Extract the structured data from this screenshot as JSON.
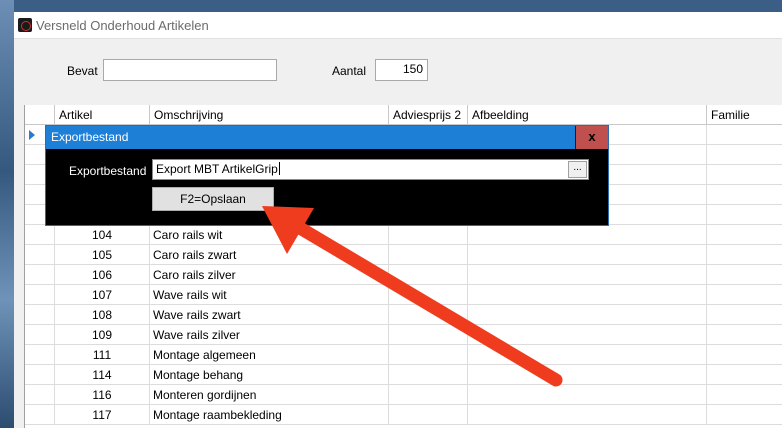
{
  "window": {
    "title": "Versneld Onderhoud Artikelen"
  },
  "filters": {
    "bevat_label": "Bevat",
    "bevat_value": "",
    "aantal_label": "Aantal",
    "aantal_value": "150"
  },
  "grid": {
    "columns": [
      "Artikel",
      "Omschrijving",
      "Adviesprijs 2",
      "Afbeelding",
      "Familie"
    ],
    "rows": [
      {
        "artikel": "104",
        "omschrijving": "Caro rails wit"
      },
      {
        "artikel": "105",
        "omschrijving": "Caro rails zwart"
      },
      {
        "artikel": "106",
        "omschrijving": "Caro rails zilver"
      },
      {
        "artikel": "107",
        "omschrijving": "Wave rails wit"
      },
      {
        "artikel": "108",
        "omschrijving": "Wave rails zwart"
      },
      {
        "artikel": "109",
        "omschrijving": "Wave rails zilver"
      },
      {
        "artikel": "111",
        "omschrijving": "Montage algemeen"
      },
      {
        "artikel": "114",
        "omschrijving": "Montage behang"
      },
      {
        "artikel": "116",
        "omschrijving": "Monteren gordijnen"
      },
      {
        "artikel": "117",
        "omschrijving": "Montage raambekleding"
      }
    ]
  },
  "dialog": {
    "title": "Exportbestand",
    "close_label": "x",
    "field_label": "Exportbestand",
    "field_value": "Export  MBT ArtikelGrip",
    "browse_label": "...",
    "save_label": "F2=Opslaan"
  },
  "annotation": {
    "arrow_color": "#f03c1e"
  }
}
